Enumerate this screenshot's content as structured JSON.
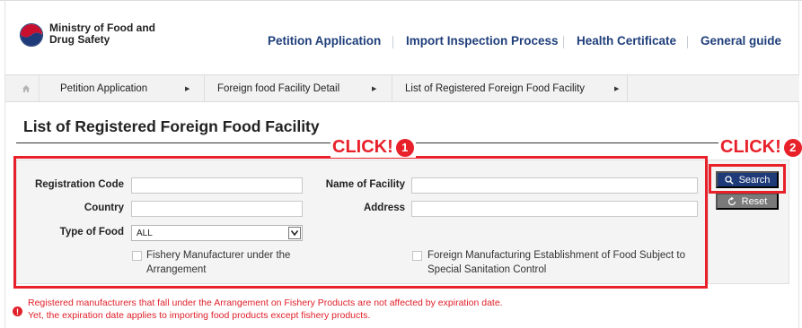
{
  "header": {
    "ministry_line1": "Ministry of Food and",
    "ministry_line2": "Drug Safety",
    "nav": [
      "Petition Application",
      "Import Inspection Process",
      "Health Certificate",
      "General guide"
    ]
  },
  "breadcrumb": {
    "home_icon": "home-icon",
    "items": [
      "Petition Application",
      "Foreign food Facility Detail",
      "List of Registered Foreign Food Facility"
    ]
  },
  "page": {
    "title": "List of Registered Foreign Food Facility"
  },
  "form": {
    "registration_code_label": "Registration Code",
    "registration_code_value": "",
    "name_of_facility_label": "Name of Facility",
    "name_of_facility_value": "",
    "country_label": "Country",
    "country_value": "",
    "address_label": "Address",
    "address_value": "",
    "type_of_food_label": "Type of Food",
    "type_of_food_selected": "ALL",
    "checkbox1_label_line1": "Fishery Manufacturer under the",
    "checkbox1_label_line2": "Arrangement",
    "checkbox2_label_line1": "Foreign Manufacturing Establishment of Food Subject to",
    "checkbox2_label_line2": "Special Sanitation Control"
  },
  "buttons": {
    "search_label": "Search",
    "reset_label": "Reset"
  },
  "annotations": {
    "click1_text": "CLICK!",
    "click1_num": "1",
    "click2_text": "CLICK!",
    "click2_num": "2",
    "color": "#e8202a"
  },
  "notice": {
    "line1": "Registered manufacturers that fall under the Arrangement on Fishery Products are not affected by expiration date.",
    "line2": "Yet, the expiration date applies to importing food products except fishery products.",
    "icon": "!"
  },
  "colors": {
    "brand_navy": "#1e3a78",
    "nav_text": "#1f3e7a",
    "reset_gray": "#7a7a7a",
    "alert_red": "#e0202a"
  }
}
